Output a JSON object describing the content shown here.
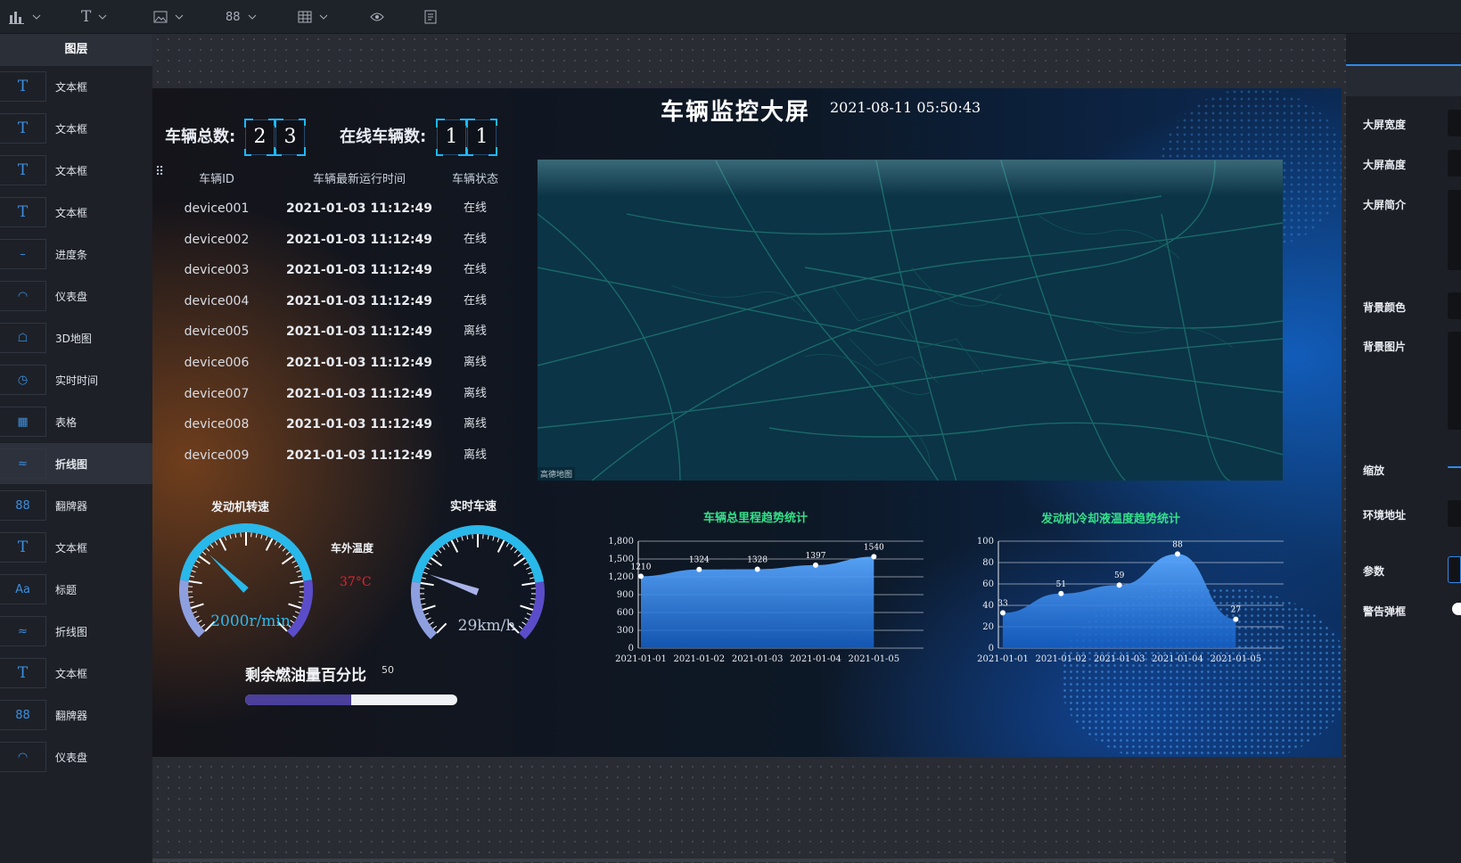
{
  "toolbar": {
    "items": [
      {
        "icon": "bar-chart-icon"
      },
      {
        "icon": "text-icon"
      },
      {
        "icon": "image-icon"
      },
      {
        "icon": "flip-counter-icon"
      },
      {
        "icon": "table-icon"
      },
      {
        "icon": "preview-eye-icon"
      },
      {
        "icon": "notes-icon"
      }
    ]
  },
  "layers_panel": {
    "title": "图层",
    "items": [
      {
        "label": "文本框",
        "icon": "text-icon"
      },
      {
        "label": "文本框",
        "icon": "text-icon"
      },
      {
        "label": "文本框",
        "icon": "text-icon"
      },
      {
        "label": "文本框",
        "icon": "text-icon"
      },
      {
        "label": "进度条",
        "icon": "progress-icon"
      },
      {
        "label": "仪表盘",
        "icon": "gauge-icon"
      },
      {
        "label": "3D地图",
        "icon": "map-icon"
      },
      {
        "label": "实时时间",
        "icon": "clock-icon"
      },
      {
        "label": "表格",
        "icon": "table-icon"
      },
      {
        "label": "折线图",
        "icon": "line-chart-icon",
        "active": true
      },
      {
        "label": "翻牌器",
        "icon": "flip-counter-icon"
      },
      {
        "label": "文本框",
        "icon": "text-icon"
      },
      {
        "label": "标题",
        "icon": "title-icon"
      },
      {
        "label": "折线图",
        "icon": "line-chart-icon"
      },
      {
        "label": "文本框",
        "icon": "text-icon"
      },
      {
        "label": "翻牌器",
        "icon": "flip-counter-icon"
      },
      {
        "label": "仪表盘",
        "icon": "gauge-icon"
      }
    ]
  },
  "screen": {
    "title": "车辆监控大屏",
    "datetime": "2021-08-11 05:50:43",
    "total_label": "车辆总数:",
    "total_digits": [
      "2",
      "3"
    ],
    "online_label": "在线车辆数:",
    "online_digits": [
      "1",
      "1"
    ],
    "table": {
      "headers": [
        "车辆ID",
        "车辆最新运行时间",
        "车辆状态"
      ],
      "rows": [
        [
          "device001",
          "2021-01-03 11:12:49",
          "在线"
        ],
        [
          "device002",
          "2021-01-03 11:12:49",
          "在线"
        ],
        [
          "device003",
          "2021-01-03 11:12:49",
          "在线"
        ],
        [
          "device004",
          "2021-01-03 11:12:49",
          "在线"
        ],
        [
          "device005",
          "2021-01-03 11:12:49",
          "离线"
        ],
        [
          "device006",
          "2021-01-03 11:12:49",
          "离线"
        ],
        [
          "device007",
          "2021-01-03 11:12:49",
          "离线"
        ],
        [
          "device008",
          "2021-01-03 11:12:49",
          "离线"
        ],
        [
          "device009",
          "2021-01-03 11:12:49",
          "离线"
        ]
      ]
    },
    "map_watermark": "高德地图",
    "gauge_engine": {
      "title": "发动机转速",
      "value_text": "2000r/min",
      "level": 0.33
    },
    "gauge_speed": {
      "title": "实时车速",
      "value_text": "29km/h",
      "level": 0.22
    },
    "outside_temp": {
      "title": "车外温度",
      "value": "37°C"
    },
    "fuel": {
      "title": "剩余燃油量百分比",
      "value": "50",
      "fraction": 0.5
    },
    "colors": {
      "accent": "#1db8ff",
      "chart_title": "#35e08a",
      "temp": "#e8222e",
      "fuel_fill": "#4a3f9b"
    }
  },
  "chart_data": [
    {
      "type": "area",
      "title": "车辆总里程趋势统计",
      "categories": [
        "2021-01-01",
        "2021-01-02",
        "2021-01-03",
        "2021-01-04",
        "2021-01-05"
      ],
      "values": [
        1210,
        1324,
        1328,
        1397,
        1540
      ],
      "yticks": [
        "0",
        "300",
        "600",
        "900",
        "1,200",
        "1,500",
        "1,800"
      ],
      "ylim": [
        0,
        1800
      ],
      "grid": true
    },
    {
      "type": "area",
      "title": "发动机冷却液温度趋势统计",
      "categories": [
        "2021-01-01",
        "2021-01-02",
        "2021-01-03",
        "2021-01-04",
        "2021-01-05"
      ],
      "values": [
        33,
        51,
        59,
        88,
        27
      ],
      "yticks": [
        "0",
        "20",
        "40",
        "60",
        "80",
        "100"
      ],
      "ylim": [
        0,
        100
      ],
      "grid": true
    }
  ],
  "properties_panel": {
    "fields": [
      "大屏宽度",
      "大屏高度",
      "大屏简介",
      "背景颜色",
      "背景图片",
      "缩放",
      "环境地址",
      "参数",
      "警告弹框"
    ]
  }
}
